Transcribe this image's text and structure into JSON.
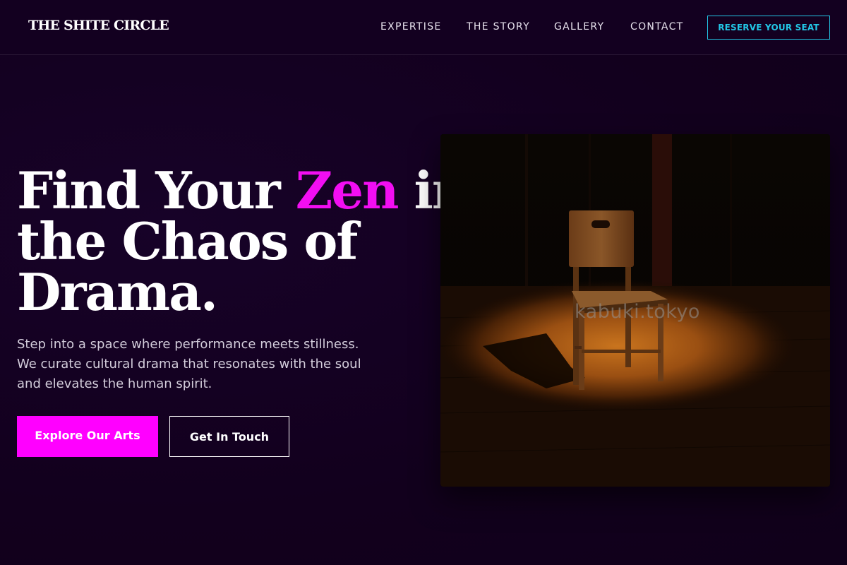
{
  "header": {
    "logo": "THE SHITE CIRCLE",
    "nav": [
      "EXPERTISE",
      "THE STORY",
      "GALLERY",
      "CONTACT"
    ],
    "cta": "RESERVE YOUR SEAT"
  },
  "hero": {
    "title_part1": "Find Your ",
    "title_accent": "Zen",
    "title_part2": " in",
    "title_line2": "the Chaos of",
    "title_line3": "Drama.",
    "subtitle_lines": [
      "Step into a space where performance meets stillness.",
      "We curate cultural drama that resonates with the soul",
      "and elevates the human spirit."
    ],
    "primary_button": "Explore Our Arts",
    "secondary_button": "Get In Touch",
    "image_watermark": "kabuki.tokyo",
    "image_subject": "wooden-chair-spotlight"
  },
  "colors": {
    "background": "#12001d",
    "accent_magenta": "#ff00ff",
    "accent_cyan": "#22c6e6",
    "text": "#ffffff"
  }
}
